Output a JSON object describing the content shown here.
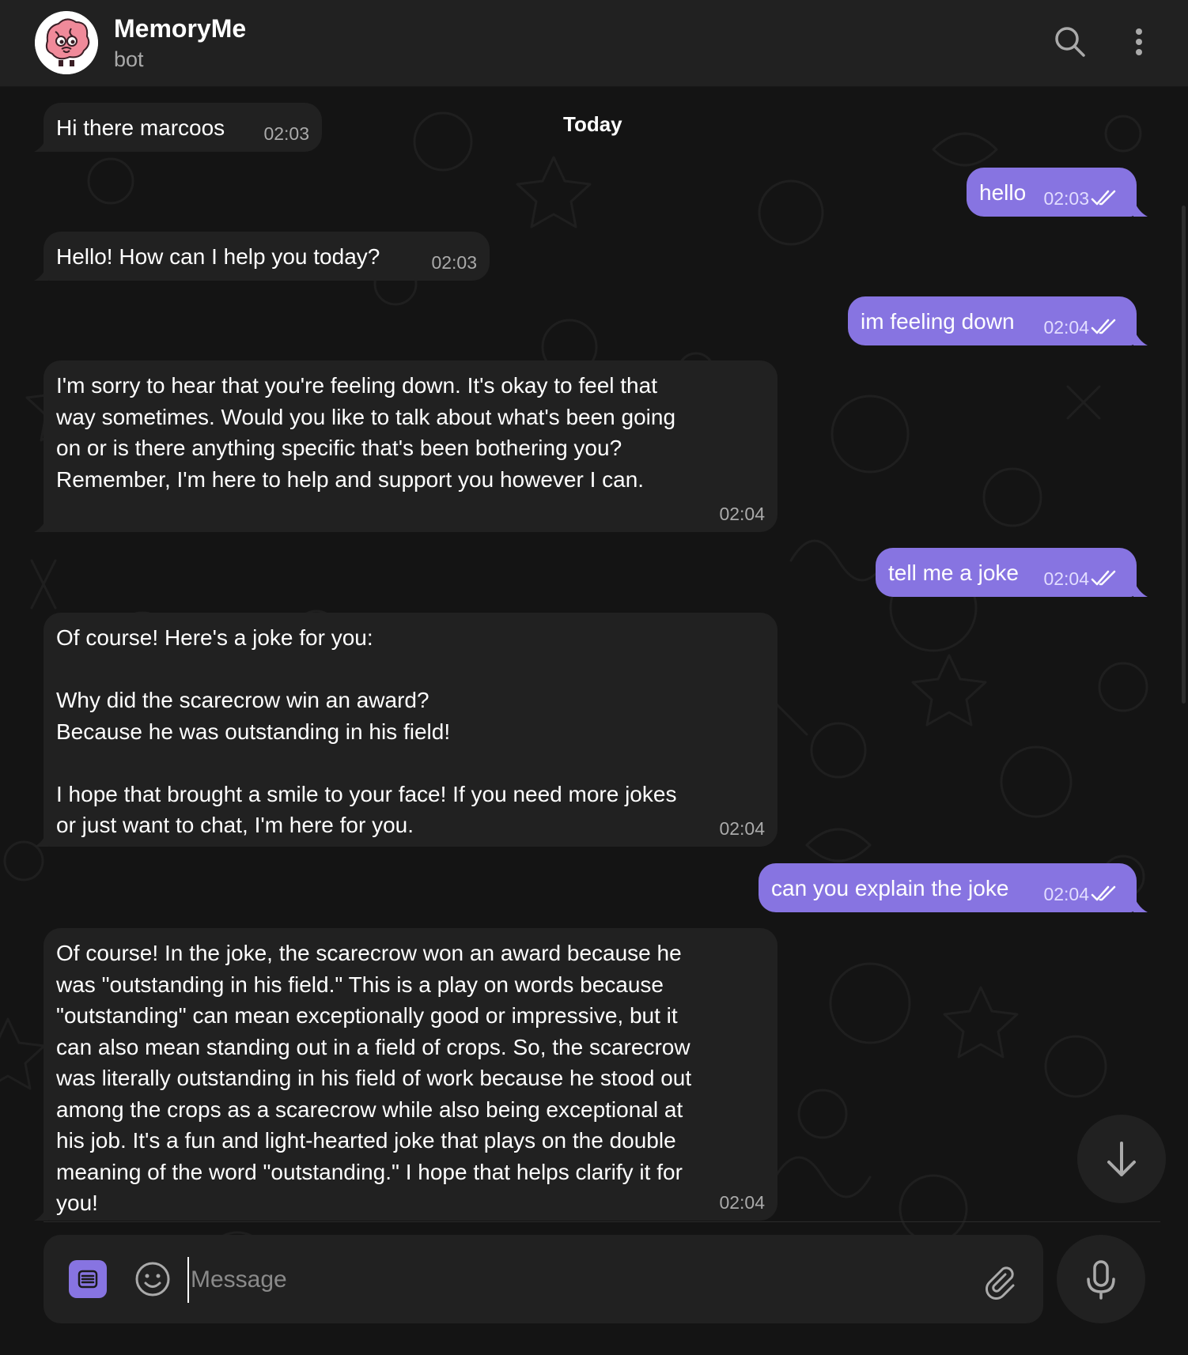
{
  "header": {
    "title": "MemoryMe",
    "subtitle": "bot"
  },
  "date_chip": "Today",
  "messages": [
    {
      "side": "in",
      "text": "Hi there marcoos",
      "time": "02:03"
    },
    {
      "side": "out",
      "text": "hello",
      "time": "02:03",
      "read": true
    },
    {
      "side": "in",
      "text": "Hello! How can I help you today?",
      "time": "02:03"
    },
    {
      "side": "out",
      "text": "im feeling down",
      "time": "02:04",
      "read": true
    },
    {
      "side": "in",
      "text": "I'm sorry to hear that you're feeling down. It's okay to feel that\nway sometimes. Would you like to talk about what's been going\non or is there anything specific that's been bothering you?\nRemember, I'm here to help and support you however I can.",
      "time": "02:04"
    },
    {
      "side": "out",
      "text": "tell me a joke",
      "time": "02:04",
      "read": true
    },
    {
      "side": "in",
      "text": "Of course! Here's a joke for you:\n\nWhy did the scarecrow win an award?\nBecause he was outstanding in his field!\n\nI hope that brought a smile to your face! If you need more jokes\nor just want to chat, I'm here for you.",
      "time": "02:04"
    },
    {
      "side": "out",
      "text": "can you explain the joke",
      "time": "02:04",
      "read": true
    },
    {
      "side": "in",
      "text": "Of course! In the joke, the scarecrow won an award because he\nwas \"outstanding in his field.\" This is a play on words because\n\"outstanding\" can mean exceptionally good or impressive, but it\ncan also mean standing out in a field of crops. So, the scarecrow\nwas literally outstanding in his field of work because he stood out\namong the crops as a scarecrow while also being exceptional at\nhis job. It's a fun and light-hearted joke that plays on the double\nmeaning of the word \"outstanding.\" I hope that helps clarify it for\nyou!",
      "time": "02:04"
    }
  ],
  "composer": {
    "placeholder": "Message"
  },
  "icons": {
    "search": "search-icon",
    "more": "more-vertical-icon",
    "menu": "bot-menu-icon",
    "emoji": "emoji-icon",
    "attach": "paperclip-icon",
    "mic": "microphone-icon",
    "scroll": "arrow-down-icon",
    "read": "double-check-icon"
  },
  "colors": {
    "background": "#141414",
    "header": "#212121",
    "incoming_bubble": "#212121",
    "outgoing_bubble": "#8774e1",
    "accent": "#8774e1"
  }
}
